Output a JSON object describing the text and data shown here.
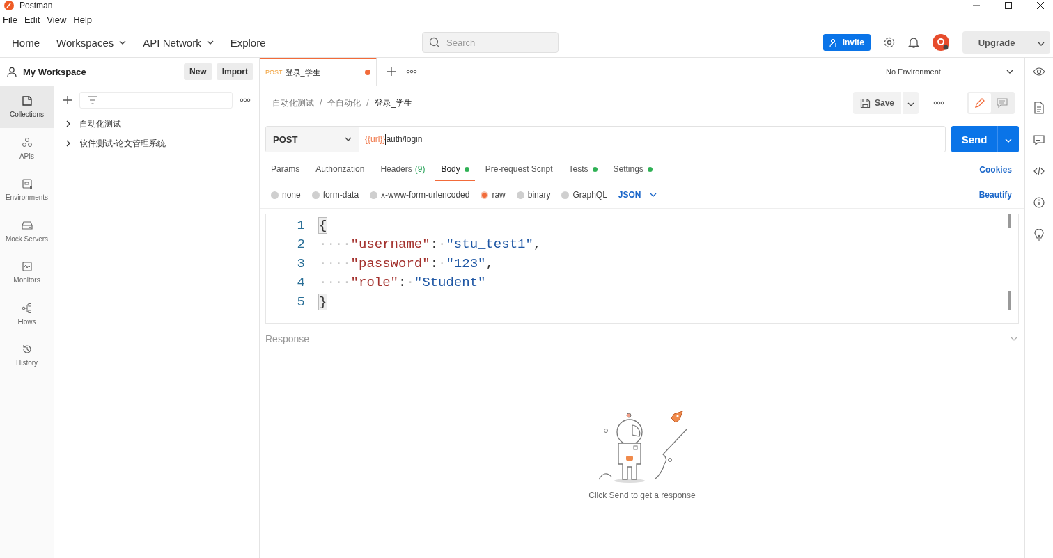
{
  "window": {
    "title": "Postman"
  },
  "menu": [
    "File",
    "Edit",
    "View",
    "Help"
  ],
  "nav": [
    {
      "label": "Home",
      "has_menu": false
    },
    {
      "label": "Workspaces",
      "has_menu": true
    },
    {
      "label": "API Network",
      "has_menu": true
    },
    {
      "label": "Explore",
      "has_menu": false
    }
  ],
  "search": {
    "placeholder": "Search"
  },
  "invite": "Invite",
  "upgrade": "Upgrade",
  "workspace": {
    "name": "My Workspace",
    "buttons": [
      "New",
      "Import"
    ]
  },
  "rail": [
    {
      "label": "Collections",
      "kind": "collections",
      "selected": true
    },
    {
      "label": "APIs",
      "kind": "apis",
      "selected": false
    },
    {
      "label": "Environments",
      "kind": "environments",
      "selected": false
    },
    {
      "label": "Mock Servers",
      "kind": "mock",
      "selected": false
    },
    {
      "label": "Monitors",
      "kind": "monitors",
      "selected": false
    },
    {
      "label": "Flows",
      "kind": "flows",
      "selected": false
    },
    {
      "label": "History",
      "kind": "history",
      "selected": false
    }
  ],
  "collections": [
    {
      "name": "自动化测试",
      "expanded": false
    },
    {
      "name": "软件测试-论文管理系统",
      "expanded": false
    }
  ],
  "tabs": [
    {
      "method": "POST",
      "name": "登录_学生",
      "unsaved": true,
      "selected": true
    }
  ],
  "environment": "No Environment",
  "breadcrumb": [
    "自动化测试",
    "全自动化",
    "登录_学生"
  ],
  "breadcrumb_separator": "/",
  "mode": [
    {
      "kind": "edit",
      "selected": true
    },
    {
      "kind": "comment",
      "selected": false
    }
  ],
  "save": "Save",
  "request": {
    "method": "POST",
    "url_variable": "{{url}}",
    "url_path": "auth/login",
    "send": "Send"
  },
  "request_tabs": [
    {
      "label": "Params",
      "dot": false,
      "selected": false
    },
    {
      "label": "Authorization",
      "dot": false,
      "selected": false
    },
    {
      "label": "Headers",
      "count": "(9)",
      "dot": false,
      "selected": false
    },
    {
      "label": "Body",
      "dot": true,
      "selected": true
    },
    {
      "label": "Pre-request Script",
      "dot": false,
      "selected": false
    },
    {
      "label": "Tests",
      "dot": true,
      "selected": false
    },
    {
      "label": "Settings",
      "dot": true,
      "selected": false
    }
  ],
  "cookies": "Cookies",
  "body_types": [
    {
      "label": "none",
      "selected": false
    },
    {
      "label": "form-data",
      "selected": false
    },
    {
      "label": "x-www-form-urlencoded",
      "selected": false
    },
    {
      "label": "raw",
      "selected": true
    },
    {
      "label": "binary",
      "selected": false
    },
    {
      "label": "GraphQL",
      "selected": false
    }
  ],
  "format": "JSON",
  "beautify": "Beautify",
  "code": [
    {
      "number": "1",
      "tokens": [
        {
          "kind": "punct",
          "text": "{"
        }
      ]
    },
    {
      "number": "2",
      "tokens": [
        {
          "kind": "ws",
          "text": "····"
        },
        {
          "kind": "key",
          "text": "\"username\""
        },
        {
          "kind": "punct",
          "text": ":"
        },
        {
          "kind": "ws",
          "text": "·"
        },
        {
          "kind": "string",
          "text": "\"stu_test1\""
        },
        {
          "kind": "punct",
          "text": ","
        }
      ]
    },
    {
      "number": "3",
      "tokens": [
        {
          "kind": "ws",
          "text": "····"
        },
        {
          "kind": "key",
          "text": "\"password\""
        },
        {
          "kind": "punct",
          "text": ":"
        },
        {
          "kind": "ws",
          "text": "·"
        },
        {
          "kind": "string",
          "text": "\"123\""
        },
        {
          "kind": "punct",
          "text": ","
        }
      ]
    },
    {
      "number": "4",
      "tokens": [
        {
          "kind": "ws",
          "text": "····"
        },
        {
          "kind": "key",
          "text": "\"role\""
        },
        {
          "kind": "punct",
          "text": ":"
        },
        {
          "kind": "ws",
          "text": "·"
        },
        {
          "kind": "string",
          "text": "\"Student\""
        }
      ]
    },
    {
      "number": "5",
      "tokens": [
        {
          "kind": "punct",
          "text": "}"
        }
      ]
    }
  ],
  "response": {
    "title": "Response",
    "hint": "Click Send to get a response"
  }
}
